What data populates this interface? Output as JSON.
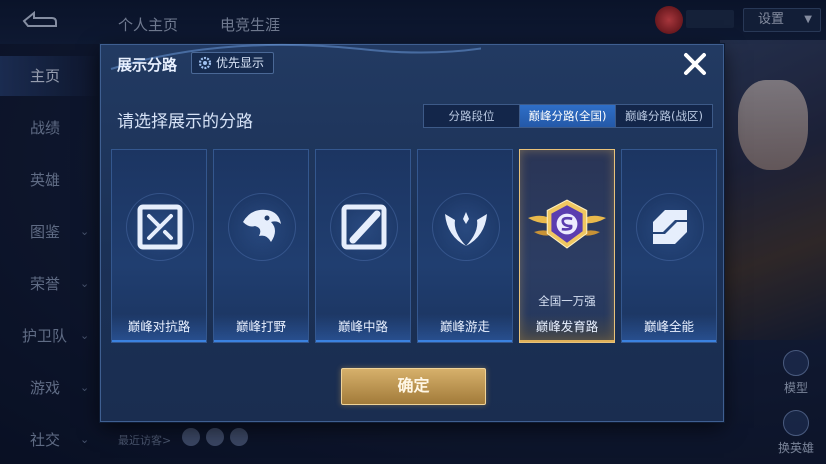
{
  "topbar": {
    "tabs": [
      "个人主页",
      "电竞生涯"
    ],
    "settings_label": "设置"
  },
  "sidebar": {
    "items": [
      {
        "label": "主页",
        "active": true,
        "chevron": false
      },
      {
        "label": "战绩",
        "active": false,
        "chevron": false
      },
      {
        "label": "英雄",
        "active": false,
        "chevron": false
      },
      {
        "label": "图鉴",
        "active": false,
        "chevron": true
      },
      {
        "label": "荣誉",
        "active": false,
        "chevron": true
      },
      {
        "label": "护卫队",
        "active": false,
        "chevron": true
      },
      {
        "label": "游戏",
        "active": false,
        "chevron": true
      },
      {
        "label": "社交",
        "active": false,
        "chevron": true
      }
    ]
  },
  "right_panel": {
    "model_label": "模型",
    "swap_label": "换英雄"
  },
  "visitors_label": "最近访客>",
  "modal": {
    "title": "展示分路",
    "priority_label": "优先显示",
    "subtitle": "请选择展示的分路",
    "tabs": [
      {
        "label": "分路段位",
        "active": false
      },
      {
        "label": "巅峰分路(全国)",
        "active": true
      },
      {
        "label": "巅峰分路(战区)",
        "active": false
      }
    ],
    "cards": [
      {
        "label": "巅峰对抗路",
        "icon": "clash-lane-icon",
        "selected": false,
        "rank": ""
      },
      {
        "label": "巅峰打野",
        "icon": "jungle-icon",
        "selected": false,
        "rank": ""
      },
      {
        "label": "巅峰中路",
        "icon": "mid-lane-icon",
        "selected": false,
        "rank": ""
      },
      {
        "label": "巅峰游走",
        "icon": "roam-icon",
        "selected": false,
        "rank": ""
      },
      {
        "label": "巅峰发育路",
        "icon": "farm-lane-icon",
        "selected": true,
        "rank": "全国一万强"
      },
      {
        "label": "巅峰全能",
        "icon": "all-round-icon",
        "selected": false,
        "rank": ""
      }
    ],
    "confirm_label": "确定"
  },
  "colors": {
    "accent_blue": "#2f6fc7",
    "gold": "#d6b06b",
    "modal_bg": "#1b3156"
  }
}
